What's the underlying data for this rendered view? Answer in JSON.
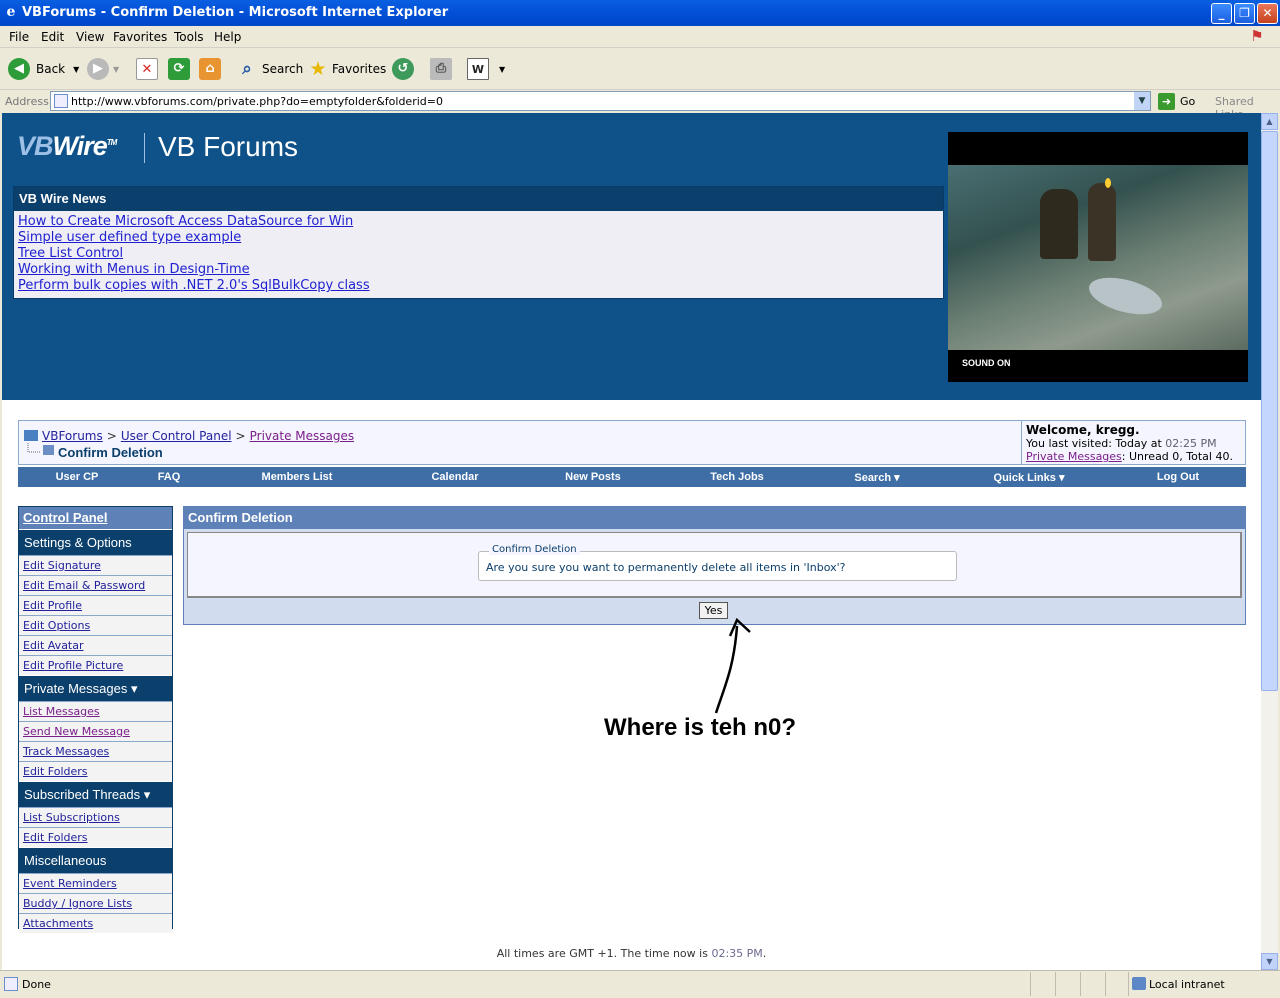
{
  "window": {
    "title": "VBForums - Confirm Deletion - Microsoft Internet Explorer",
    "minimize": "_",
    "maximize": "❐",
    "close": "✕"
  },
  "menu": [
    "File",
    "Edit",
    "View",
    "Favorites",
    "Tools",
    "Help"
  ],
  "toolbar": {
    "back": "Back",
    "search": "Search",
    "favorites": "Favorites"
  },
  "address": {
    "label": "Address",
    "url": "http://www.vbforums.com/private.php?do=emptyfolder&folderid=0",
    "go": "Go",
    "links": "Shared Links"
  },
  "header": {
    "logo_vb": "VB",
    "logo_wire": "Wire",
    "logo_tm": "TM",
    "site_title": "VB Forums",
    "news_title": "VB Wire News",
    "news": [
      "How to Create Microsoft Access DataSource for Win",
      "Simple user defined type example",
      "Tree List Control",
      "Working with Menus in Design-Time",
      "Perform bulk copies with .NET 2.0's SqlBulkCopy class"
    ],
    "video_caption": "SOUND ON"
  },
  "breadcrumb": {
    "items": [
      "VBForums",
      "User Control Panel",
      "Private Messages"
    ],
    "separator": ">",
    "current": "Confirm Deletion"
  },
  "welcome": {
    "greeting": "Welcome, kregg.",
    "last_visit_prefix": "You last visited: Today at",
    "last_visit_time": "02:25 PM",
    "pm_link": "Private Messages",
    "pm_counts": ": Unread 0, Total 40."
  },
  "nav_tabs": [
    "User CP",
    "FAQ",
    "Members List",
    "Calendar",
    "New Posts",
    "Tech Jobs",
    "Search ▾",
    "Quick Links ▾",
    "Log Out"
  ],
  "control_panel": {
    "title": "Control Panel",
    "settings_header": "Settings & Options",
    "settings_items": [
      "Edit Signature",
      "Edit Email & Password",
      "Edit Profile",
      "Edit Options",
      "Edit Avatar",
      "Edit Profile Picture"
    ],
    "pm_header": "Private Messages",
    "pm_items": [
      "List Messages",
      "Send New Message",
      "Track Messages",
      "Edit Folders"
    ],
    "threads_header": "Subscribed Threads",
    "threads_items": [
      "List Subscriptions",
      "Edit Folders"
    ],
    "misc_header": "Miscellaneous",
    "misc_items": [
      "Event Reminders",
      "Buddy / Ignore Lists",
      "Attachments"
    ],
    "dropdown_glyph": "▾"
  },
  "confirm": {
    "title": "Confirm Deletion",
    "legend": "Confirm Deletion",
    "question": "Are you sure you want to permanently delete all items in 'Inbox'?",
    "yes_label": "Yes"
  },
  "annotation": "Where is teh n0?",
  "footer": {
    "prefix": "All times are GMT +1. The time now is",
    "time": "02:35 PM",
    "suffix": "."
  },
  "status": {
    "text": "Done",
    "zone": "Local intranet"
  },
  "colors": {
    "header_bg": "#0e5289",
    "nav_bar": "#3e6ea5",
    "panel_header": "#5e82b8",
    "section_bg": "#0b3f6c"
  }
}
